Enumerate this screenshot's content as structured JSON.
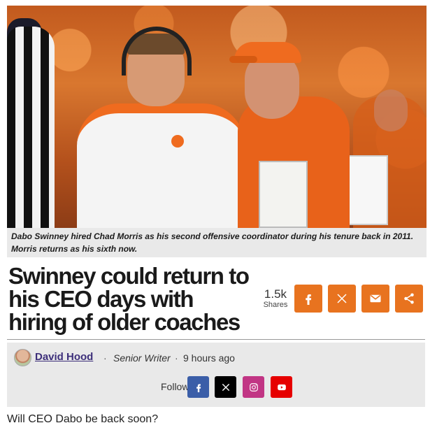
{
  "photo": {
    "alt": "",
    "caption": "Dabo Swinney hired Chad Morris as his second offensive coordinator during his tenure back in 2011. Morris returns as his sixth now."
  },
  "article": {
    "headline": "Swinney could return to his CEO days with hiring of older coaches",
    "intro": "Will CEO Dabo be back soon?"
  },
  "share": {
    "count": "1.5k",
    "count_label": "Shares",
    "buttons": [
      "facebook-icon",
      "x-icon",
      "email-icon",
      "share-icon"
    ],
    "color": "#e8731f"
  },
  "byline": {
    "author": "David Hood",
    "separator": "·",
    "role": "Senior Writer",
    "time": "9 hours ago"
  },
  "follow": {
    "label": "Follow",
    "buttons": [
      {
        "icon": "facebook-icon",
        "color": "#3b5ea8"
      },
      {
        "icon": "x-icon",
        "color": "#000000"
      },
      {
        "icon": "instagram-icon",
        "color": "#c13584"
      },
      {
        "icon": "youtube-icon",
        "color": "#e60000"
      }
    ]
  }
}
